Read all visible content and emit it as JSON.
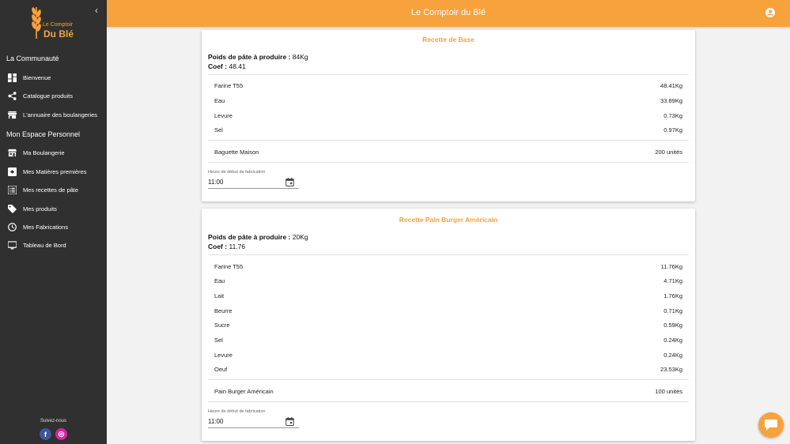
{
  "brand": {
    "line1": "Le Comptoir",
    "line2": "Du Blé"
  },
  "header": {
    "title": "Le Comptoir du Blé"
  },
  "sidebar": {
    "section1": "La Communauté",
    "section2": "Mon Espace Personnel",
    "items": [
      {
        "label": "Bienvenue",
        "icon": "dashboard-icon"
      },
      {
        "label": "Catalogue produits",
        "icon": "share-icon"
      },
      {
        "label": "L'annuaire des boulangeries",
        "icon": "store-icon"
      },
      {
        "label": "Ma Boulangerie",
        "icon": "storefront-icon"
      },
      {
        "label": "Mes Matières premières",
        "icon": "inventory-icon"
      },
      {
        "label": "Mes recettes de pâte",
        "icon": "list-icon"
      },
      {
        "label": "Mes produits",
        "icon": "tag-icon"
      },
      {
        "label": "Mes Fabrications",
        "icon": "clock-icon"
      },
      {
        "label": "Tableau de Bord",
        "icon": "monitor-icon"
      }
    ],
    "follow": "Suivez-nous",
    "facebook": "f",
    "instagram": "◎"
  },
  "recipes": [
    {
      "title": "Recette de Base",
      "weight_label": "Poids de pâte à produire :",
      "weight_value": "84Kg",
      "coef_label": "Coef :",
      "coef_value": "48.41",
      "ingredients": [
        {
          "name": "Farine T55",
          "qty": "48.41Kg"
        },
        {
          "name": "Eau",
          "qty": "33.89Kg"
        },
        {
          "name": "Levure",
          "qty": "0.73Kg"
        },
        {
          "name": "Sel",
          "qty": "0.97Kg"
        }
      ],
      "product": {
        "name": "Baguette Maison",
        "qty": "200 unités"
      },
      "start_label": "Heure de début de fabrication",
      "start_value": "11:00"
    },
    {
      "title": "Recette Pain Burger Américain",
      "weight_label": "Poids de pâte à produire :",
      "weight_value": "20Kg",
      "coef_label": "Coef :",
      "coef_value": "11.76",
      "ingredients": [
        {
          "name": "Farine T55",
          "qty": "11.76Kg"
        },
        {
          "name": "Eau",
          "qty": "4.71Kg"
        },
        {
          "name": "Lait",
          "qty": "1.76Kg"
        },
        {
          "name": "Beurre",
          "qty": "0.71Kg"
        },
        {
          "name": "Sucre",
          "qty": "0.59Kg"
        },
        {
          "name": "Sel",
          "qty": "0.24Kg"
        },
        {
          "name": "Levure",
          "qty": "0.24Kg"
        },
        {
          "name": "Oeuf",
          "qty": "23.53Kg"
        }
      ],
      "product": {
        "name": "Pain Burger Américain",
        "qty": "100 unités"
      },
      "start_label": "Heure de début de fabrication",
      "start_value": "11:00"
    }
  ],
  "colors": {
    "accent": "#f7a23c",
    "sidebar": "#303030"
  }
}
